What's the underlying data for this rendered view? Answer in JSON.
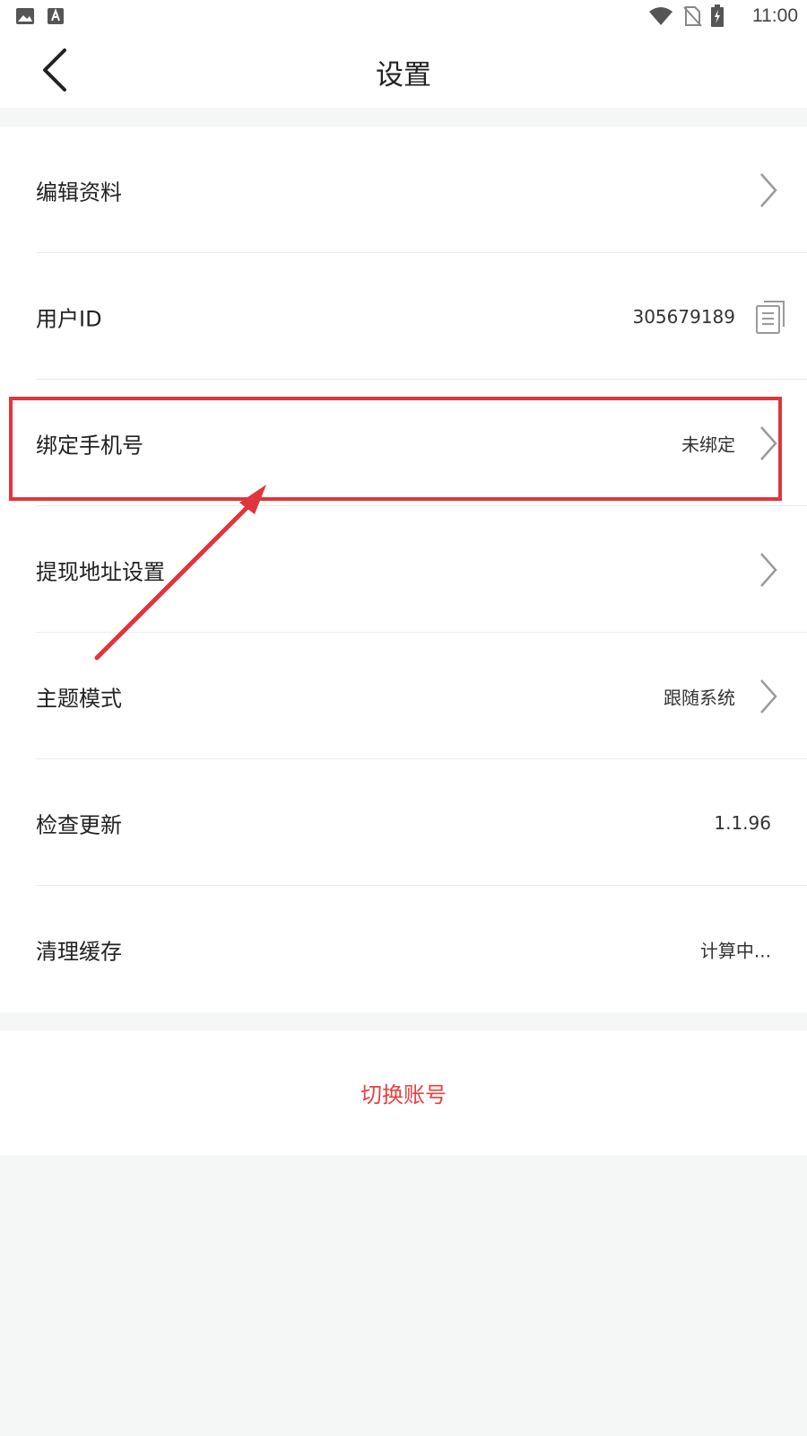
{
  "status_bar": {
    "time": "11:00",
    "left_icons": [
      "image-icon",
      "a-badge-icon"
    ],
    "right_icons": [
      "wifi-icon",
      "no-sim-icon",
      "battery-charging-icon"
    ]
  },
  "header": {
    "title": "设置",
    "back_icon": "chevron-left-icon"
  },
  "settings": {
    "items": [
      {
        "label": "编辑资料",
        "value": "",
        "trailing": "chevron-right-icon"
      },
      {
        "label": "用户ID",
        "value": "305679189",
        "trailing": "copy-icon"
      },
      {
        "label": "绑定手机号",
        "value": "未绑定",
        "trailing": "chevron-right-icon"
      },
      {
        "label": "提现地址设置",
        "value": "",
        "trailing": "chevron-right-icon"
      },
      {
        "label": "主题模式",
        "value": "跟随系统",
        "trailing": "chevron-right-icon"
      },
      {
        "label": "检查更新",
        "value": "1.1.96",
        "trailing": ""
      },
      {
        "label": "清理缓存",
        "value": "计算中...",
        "trailing": ""
      }
    ]
  },
  "switch_account": {
    "label": "切换账号"
  },
  "colors": {
    "accent_red": "#e84040",
    "annotation_red": "#e0353b",
    "page_background": "#f5f6f6",
    "card_background": "#ffffff",
    "chevron_gray": "#9a9a9a"
  }
}
